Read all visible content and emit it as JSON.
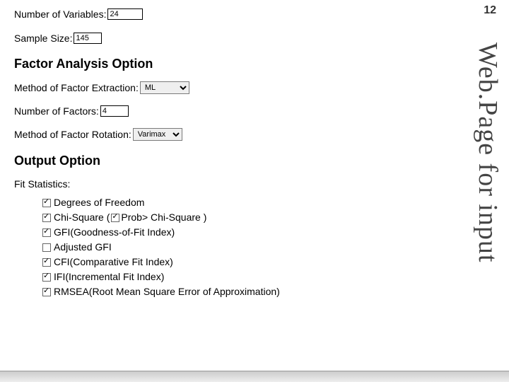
{
  "page_number": "12",
  "side_title": "Web.Page for input",
  "fields": {
    "num_vars_label": "Number of Variables:",
    "num_vars_value": "24",
    "sample_size_label": "Sample Size:",
    "sample_size_value": "145"
  },
  "factor_section": {
    "heading": "Factor Analysis Option",
    "extraction_label": "Method of Factor Extraction:",
    "extraction_value": "ML",
    "num_factors_label": "Number of Factors:",
    "num_factors_value": "4",
    "rotation_label": "Method of Factor Rotation:",
    "rotation_value": "Varimax"
  },
  "output_section": {
    "heading": "Output Option",
    "fit_label": "Fit Statistics:",
    "items": [
      {
        "checked": true,
        "label": "Degrees of Freedom"
      },
      {
        "checked": true,
        "pre": "Chi-Square ( ",
        "inner_checked": true,
        "post": " Prob> Chi-Square )"
      },
      {
        "checked": true,
        "label": "GFI(Goodness-of-Fit Index)"
      },
      {
        "checked": false,
        "label": "Adjusted GFI"
      },
      {
        "checked": true,
        "label": "CFI(Comparative Fit Index)"
      },
      {
        "checked": true,
        "label": "IFI(Incremental Fit Index)"
      },
      {
        "checked": true,
        "label": "RMSEA(Root Mean Square Error of Approximation)"
      }
    ]
  }
}
